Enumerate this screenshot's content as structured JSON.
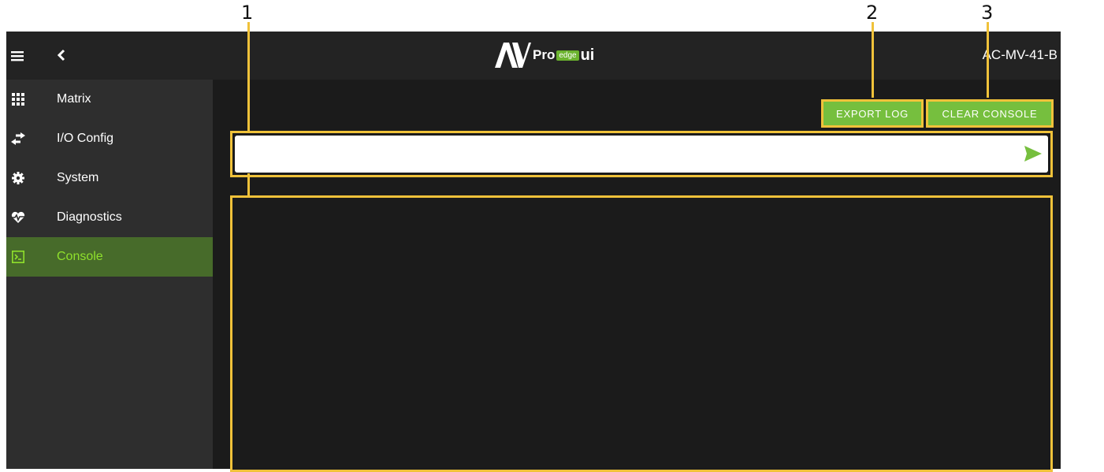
{
  "callouts": [
    "1",
    "2",
    "3"
  ],
  "header": {
    "logo_av": "AV",
    "logo_pro": "Pro",
    "logo_edge": "edge",
    "logo_ui": "ui",
    "device_name": "AC-MV-41-B"
  },
  "sidebar": {
    "items": [
      {
        "label": "Matrix",
        "icon": "grid-icon"
      },
      {
        "label": "I/O Config",
        "icon": "swap-arrows-icon"
      },
      {
        "label": "System",
        "icon": "gear-icon"
      },
      {
        "label": "Diagnostics",
        "icon": "heartbeat-icon"
      },
      {
        "label": "Console",
        "icon": "terminal-icon",
        "active": true
      }
    ]
  },
  "toolbar": {
    "export_label": "EXPORT LOG",
    "clear_label": "CLEAR CONSOLE"
  },
  "command": {
    "value": "",
    "placeholder": ""
  },
  "colors": {
    "accent": "#76bf3e",
    "callout": "#f0c23a",
    "active_text": "#8fe02c",
    "active_bg": "#476b2a"
  }
}
